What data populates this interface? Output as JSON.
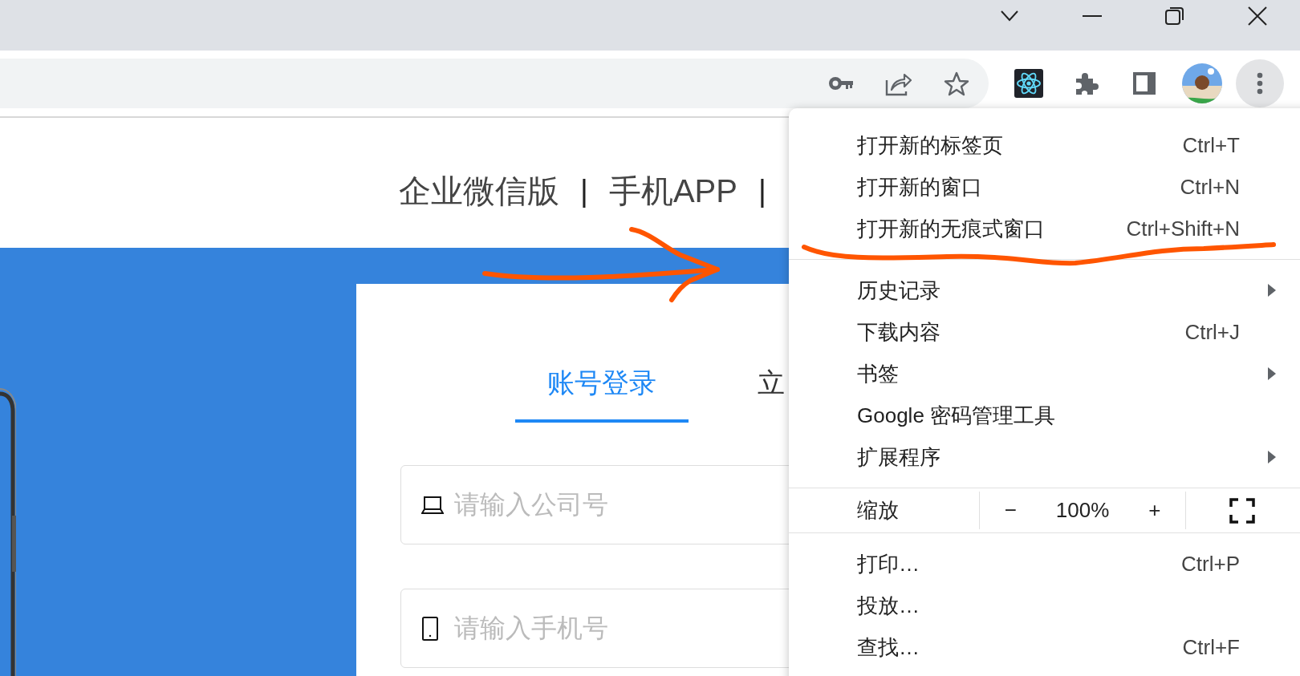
{
  "nav": [
    {
      "kind": "link",
      "text": "企业微信版"
    },
    {
      "kind": "separator",
      "text": "|"
    },
    {
      "kind": "link",
      "text": "手机APP"
    },
    {
      "kind": "separator",
      "text": "|"
    }
  ],
  "login_tabs": [
    {
      "label": "账号登录",
      "selected": true
    },
    {
      "label": "立",
      "selected": false
    }
  ],
  "fields": [
    {
      "kind": "company",
      "placeholder": "请输入公司号"
    },
    {
      "kind": "phone",
      "placeholder": "请输入手机号"
    }
  ],
  "menu": [
    {
      "kind": "items",
      "items": [
        {
          "label": "打开新的标签页",
          "shortcut": "Ctrl+T",
          "submenu": false
        },
        {
          "label": "打开新的窗口",
          "shortcut": "Ctrl+N",
          "submenu": false
        },
        {
          "label": "打开新的无痕式窗口",
          "shortcut": "Ctrl+Shift+N",
          "submenu": false
        }
      ]
    },
    {
      "kind": "items",
      "items": [
        {
          "label": "历史记录",
          "submenu": true
        },
        {
          "label": "下载内容",
          "shortcut": "Ctrl+J",
          "submenu": false
        },
        {
          "label": "书签",
          "submenu": true
        },
        {
          "label": "Google 密码管理工具",
          "submenu": false
        },
        {
          "label": "扩展程序",
          "submenu": true
        }
      ]
    },
    {
      "kind": "zoom",
      "label": "缩放",
      "minus": "−",
      "value": "100%",
      "plus": "+"
    },
    {
      "kind": "items",
      "items": [
        {
          "label": "打印…",
          "shortcut": "Ctrl+P",
          "submenu": false
        },
        {
          "label": "投放…",
          "submenu": false
        },
        {
          "label": "查找…",
          "shortcut": "Ctrl+F",
          "submenu": false
        }
      ]
    }
  ]
}
